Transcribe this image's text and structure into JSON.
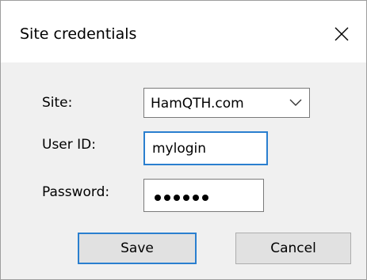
{
  "dialog": {
    "title": "Site credentials",
    "close_icon": "close-icon"
  },
  "form": {
    "site_label": "Site:",
    "site_value": "HamQTH.com",
    "user_label": "User ID:",
    "user_value": "mylogin",
    "password_label": "Password:",
    "password_masked_length": 6
  },
  "buttons": {
    "save": "Save",
    "cancel": "Cancel"
  },
  "colors": {
    "focus_accent": "#2a7fcf",
    "dialog_background": "#f0f0f0",
    "titlebar_background": "#ffffff"
  }
}
